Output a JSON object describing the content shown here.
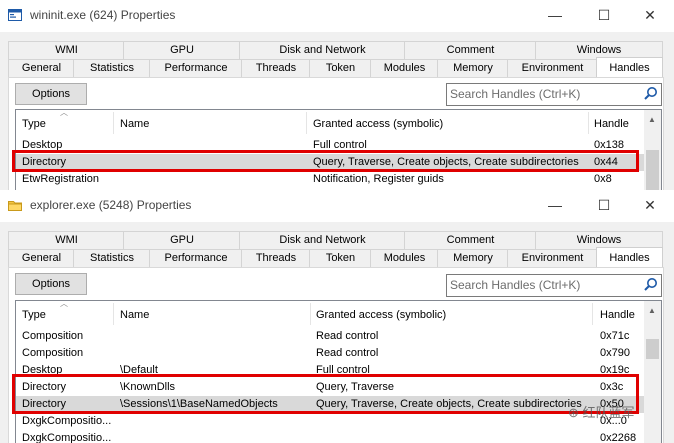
{
  "window1": {
    "title": "wininit.exe (624) Properties",
    "tabs_top": [
      "WMI",
      "GPU",
      "Disk and Network",
      "Comment",
      "Windows"
    ],
    "tabs_bottom": [
      "General",
      "Statistics",
      "Performance",
      "Threads",
      "Token",
      "Modules",
      "Memory",
      "Environment",
      "Handles"
    ],
    "options_label": "Options",
    "search_placeholder": "Search Handles (Ctrl+K)",
    "columns": [
      "Type",
      "Name",
      "Granted access (symbolic)",
      "Handle"
    ],
    "rows": [
      {
        "type": "Desktop",
        "name": "",
        "access": "Full control",
        "handle": "0x138"
      },
      {
        "type": "Directory",
        "name": "",
        "access": "Query, Traverse, Create objects, Create subdirectories",
        "handle": "0x44"
      },
      {
        "type": "EtwRegistration",
        "name": "",
        "access": "Notification, Register guids",
        "handle": "0x8"
      }
    ]
  },
  "window2": {
    "title": "explorer.exe (5248) Properties",
    "tabs_top": [
      "WMI",
      "GPU",
      "Disk and Network",
      "Comment",
      "Windows"
    ],
    "tabs_bottom": [
      "General",
      "Statistics",
      "Performance",
      "Threads",
      "Token",
      "Modules",
      "Memory",
      "Environment",
      "Handles"
    ],
    "options_label": "Options",
    "search_placeholder": "Search Handles (Ctrl+K)",
    "columns": [
      "Type",
      "Name",
      "Granted access (symbolic)",
      "Handle"
    ],
    "rows": [
      {
        "type": "Composition",
        "name": "",
        "access": "Read control",
        "handle": "0x71c"
      },
      {
        "type": "Composition",
        "name": "",
        "access": "Read control",
        "handle": "0x790"
      },
      {
        "type": "Desktop",
        "name": "\\Default",
        "access": "Full control",
        "handle": "0x19c"
      },
      {
        "type": "Directory",
        "name": "\\KnownDlls",
        "access": "Query, Traverse",
        "handle": "0x3c"
      },
      {
        "type": "Directory",
        "name": "\\Sessions\\1\\BaseNamedObjects",
        "access": "Query, Traverse, Create objects, Create subdirectories",
        "handle": "0x50"
      },
      {
        "type": "DxgkCompositio...",
        "name": "",
        "access": "",
        "handle": "0x...0"
      },
      {
        "type": "DxgkCompositio...",
        "name": "",
        "access": "",
        "handle": "0x2268"
      }
    ]
  },
  "window_buttons": {
    "minimize": "—",
    "maximize": "☐",
    "close": "✕"
  },
  "watermark": "红队蓝军",
  "colors": {
    "highlight_box": "#e00000",
    "selected_row": "#d9d9d9"
  }
}
